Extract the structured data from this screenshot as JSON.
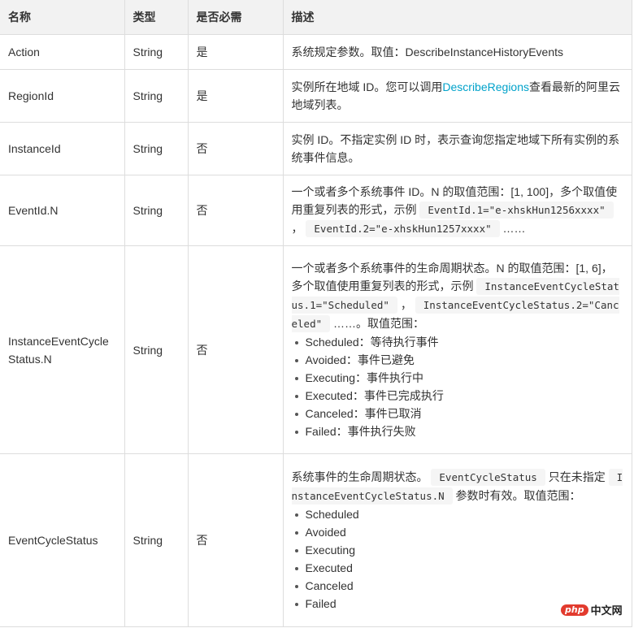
{
  "table": {
    "headers": [
      "名称",
      "类型",
      "是否必需",
      "描述"
    ],
    "rows": [
      {
        "name": "Action",
        "type": "String",
        "required": "是",
        "desc_text": "系统规定参数。取值：DescribeInstanceHistoryEvents"
      },
      {
        "name": "RegionId",
        "type": "String",
        "required": "是",
        "desc_before": "实例所在地域 ID。您可以调用",
        "desc_link": "DescribeRegions",
        "desc_after": "查看最新的阿里云地域列表。"
      },
      {
        "name": "InstanceId",
        "type": "String",
        "required": "否",
        "desc_text": "实例 ID。不指定实例 ID 时，表示查询您指定地域下所有实例的系统事件信息。"
      },
      {
        "name": "EventId.N",
        "type": "String",
        "required": "否",
        "desc_before": "一个或者多个系统事件 ID。N 的取值范围：[1, 100]，多个取值使用重复列表的形式，示例",
        "code1": "EventId.1=\"e-xhskHun1256xxxx\"",
        "sep": "，",
        "code2": "EventId.2=\"e-xhskHun1257xxxx\"",
        "desc_after": "……"
      },
      {
        "name": "InstanceEventCycleStatus.N",
        "type": "String",
        "required": "否",
        "desc_before": "一个或者多个系统事件的生命周期状态。N 的取值范围：[1, 6]，多个取值使用重复列表的形式，示例",
        "code1": "InstanceEventCycleStatus.1=\"Scheduled\"",
        "sep": "，",
        "code2": "InstanceEventCycleStatus.2=\"Canceled\"",
        "desc_after": "……。取值范围：",
        "values": [
          "Scheduled：等待执行事件",
          "Avoided：事件已避免",
          "Executing：事件执行中",
          "Executed：事件已完成执行",
          "Canceled：事件已取消",
          "Failed：事件执行失败"
        ]
      },
      {
        "name": "EventCycleStatus",
        "type": "String",
        "required": "否",
        "desc_before": "系统事件的生命周期状态。",
        "code1": "EventCycleStatus",
        "desc_mid": "只在未指定",
        "code2": "InstanceEventCycleStatus.N",
        "desc_after": "参数时有效。取值范围：",
        "values": [
          "Scheduled",
          "Avoided",
          "Executing",
          "Executed",
          "Canceled",
          "Failed"
        ]
      }
    ]
  },
  "watermark": {
    "logo_text": "php",
    "site_text": "中文网"
  },
  "colors": {
    "header_bg": "#f2f2f2",
    "border": "#dddddd",
    "link": "#00a2ca",
    "text": "#333333"
  }
}
